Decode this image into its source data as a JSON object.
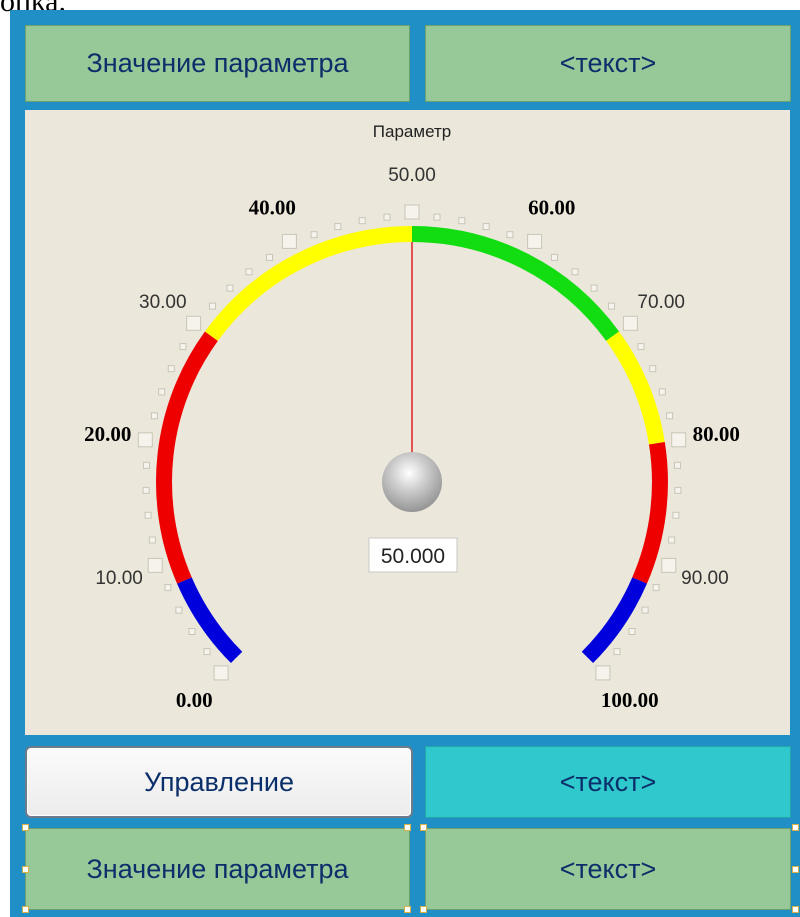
{
  "header_fragment": "опка.",
  "top_row": {
    "left_label": "Значение параметра",
    "right_label": "<текст>"
  },
  "gauge": {
    "title": "Параметр",
    "min": 0,
    "max": 100,
    "value": 50,
    "value_readout": "50.000",
    "tick_labels": [
      "0.00",
      "10.00",
      "20.00",
      "30.00",
      "40.00",
      "50.00",
      "60.00",
      "70.00",
      "80.00",
      "90.00",
      "100.00"
    ],
    "bold_tick_labels": [
      "0.00",
      "20.00",
      "40.00",
      "60.00",
      "80.00",
      "100.00"
    ],
    "color_zones": [
      {
        "from": 0,
        "to": 8,
        "color": "#0000dd"
      },
      {
        "from": 8,
        "to": 30,
        "color": "#ee0000"
      },
      {
        "from": 30,
        "to": 50,
        "color": "#ffff00"
      },
      {
        "from": 50,
        "to": 70,
        "color": "#11dd11"
      },
      {
        "from": 70,
        "to": 80,
        "color": "#ffff00"
      },
      {
        "from": 80,
        "to": 92,
        "color": "#ee0000"
      },
      {
        "from": 92,
        "to": 100,
        "color": "#0000dd"
      }
    ],
    "needle_color": "#dd2222"
  },
  "control_row": {
    "button_label": "Управление",
    "right_label": "<текст>"
  },
  "bottom_row": {
    "left_label": "Значение параметра",
    "right_label": "<текст>"
  },
  "colors": {
    "frame": "#1f8fc6",
    "cell_green": "#97c898",
    "cell_cyan": "#2fc8cc",
    "panel": "#ebe7da",
    "text": "#0b2f6a"
  }
}
